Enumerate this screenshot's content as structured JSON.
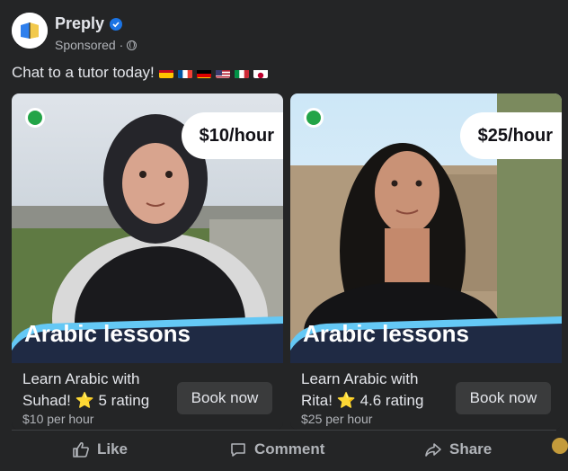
{
  "post": {
    "advertiser": "Preply",
    "sponsored_label": "Sponsored ·",
    "caption": "Chat to a tutor today!",
    "flags": [
      "Spain",
      "France",
      "Germany",
      "USA",
      "Italy",
      "Japan"
    ]
  },
  "cards": [
    {
      "price": "$10/hour",
      "title": "Arabic lessons",
      "description": "Learn Arabic with Suhad! ⭐ 5 rating",
      "subtext": "$10 per hour",
      "button": "Book now"
    },
    {
      "price": "$25/hour",
      "title": "Arabic lessons",
      "description": "Learn Arabic with Rita! ⭐ 4.6 rating",
      "subtext": "$25 per hour",
      "button": "Book now"
    }
  ],
  "actions": {
    "like": "Like",
    "comment": "Comment",
    "share": "Share"
  },
  "colors": {
    "background": "#242526",
    "online": "#22a447",
    "banner": "#1f2a44",
    "banner_accent": "#64c8f5"
  }
}
